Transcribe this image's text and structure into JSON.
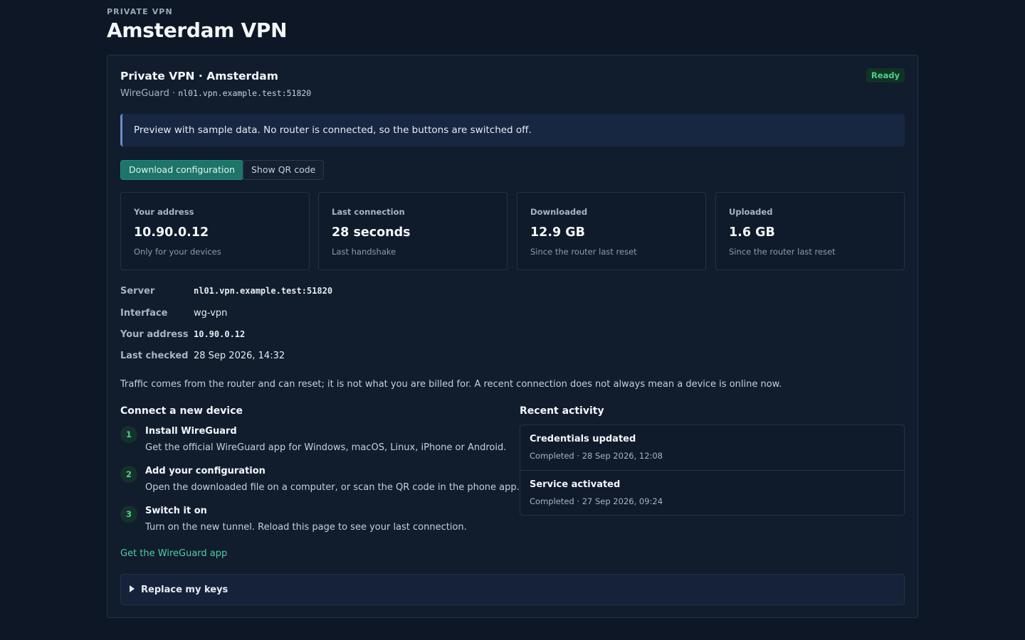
{
  "header": {
    "eyebrow": "PRIVATE VPN",
    "title": "Amsterdam VPN"
  },
  "card": {
    "title": "Private VPN · Amsterdam",
    "protocol": "WireGuard · ",
    "endpoint": "nl01.vpn.example.test:51820",
    "status": "Ready",
    "notice": "Preview with sample data. No router is connected, so the buttons are switched off.",
    "buttons": {
      "download": "Download configuration",
      "qr": "Show QR code"
    }
  },
  "stats": [
    {
      "label": "Your address",
      "value": "10.90.0.12",
      "note": "Only for your devices"
    },
    {
      "label": "Last connection",
      "value": "28 seconds",
      "note": "Last handshake"
    },
    {
      "label": "Downloaded",
      "value": "12.9 GB",
      "note": "Since the router last reset"
    },
    {
      "label": "Uploaded",
      "value": "1.6 GB",
      "note": "Since the router last reset"
    }
  ],
  "details": [
    {
      "key": "Server",
      "value": "nl01.vpn.example.test:51820"
    },
    {
      "key": "Interface",
      "value": "wg-vpn"
    },
    {
      "key": "Your address",
      "value": "10.90.0.12"
    },
    {
      "key": "Last checked",
      "value": "28 Sep 2026, 14:32"
    }
  ],
  "footnote": "Traffic comes from the router and can reset; it is not what you are billed for. A recent connection does not always mean a device is online now.",
  "setup": {
    "title": "Connect a new device",
    "steps": [
      {
        "num": "1",
        "title": "Install WireGuard",
        "desc": "Get the official WireGuard app for Windows, macOS, Linux, iPhone or Android."
      },
      {
        "num": "2",
        "title": "Add your configuration",
        "desc": "Open the downloaded file on a computer, or scan the QR code in the phone app."
      },
      {
        "num": "3",
        "title": "Switch it on",
        "desc": "Turn on the new tunnel. Reload this page to see your last connection."
      }
    ],
    "link": "Get the WireGuard app"
  },
  "activity": {
    "title": "Recent activity",
    "items": [
      {
        "title": "Credentials updated",
        "meta": "Completed · 28 Sep 2026, 12:08"
      },
      {
        "title": "Service activated",
        "meta": "Completed · 27 Sep 2026, 09:24"
      }
    ]
  },
  "replace_keys": {
    "label": "Replace my keys"
  },
  "colors": {
    "background": "#0e1726",
    "accent": "#1d7468",
    "status_ok": "#4ed08a",
    "link": "#4ecfa1"
  }
}
